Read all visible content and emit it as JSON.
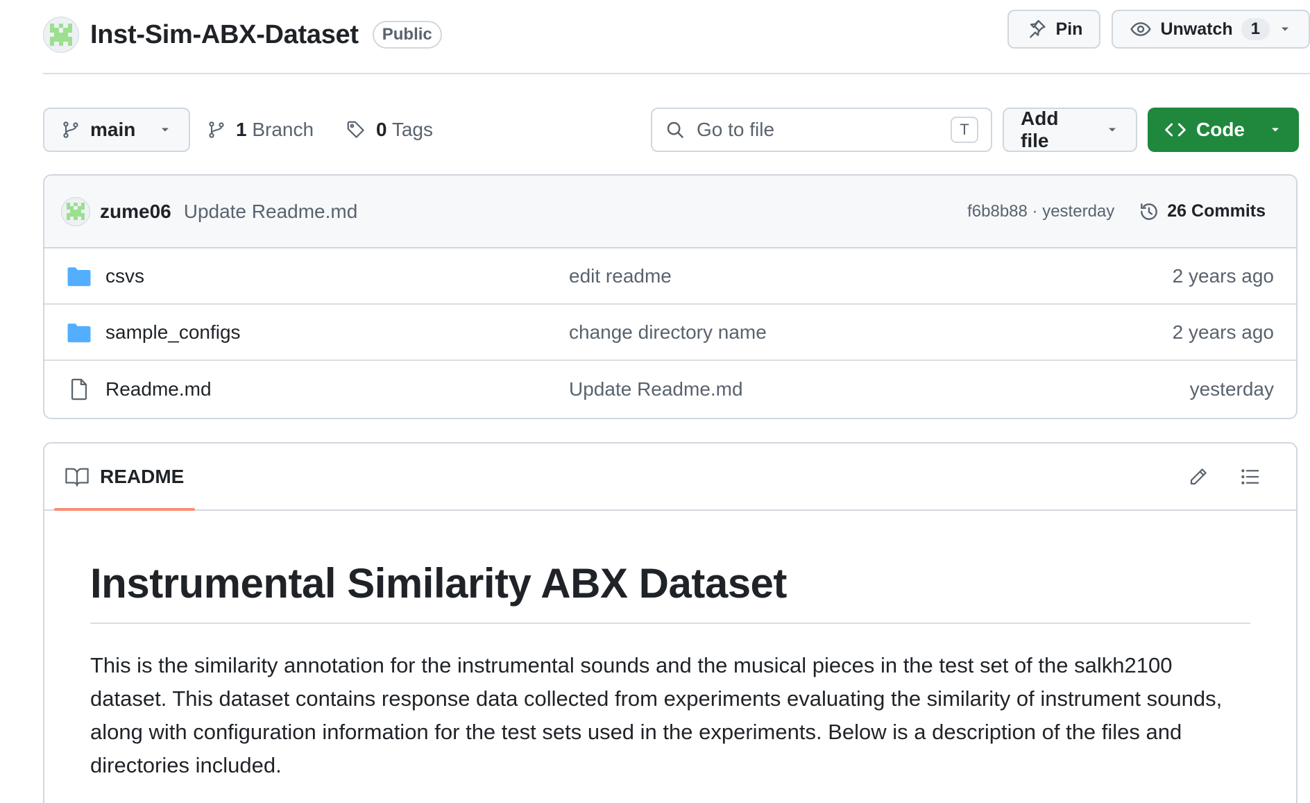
{
  "repo": {
    "name": "Inst-Sim-ABX-Dataset",
    "visibility": "Public",
    "pin_label": "Pin",
    "watch_label": "Unwatch",
    "watch_count": "1"
  },
  "toolbar": {
    "branch": "main",
    "branch_count": "1",
    "branch_label": "Branch",
    "tag_count": "0",
    "tag_label": "Tags",
    "goto_placeholder": "Go to file",
    "goto_shortcut": "T",
    "add_file_label": "Add file",
    "code_label": "Code"
  },
  "latest_commit": {
    "author": "zume06",
    "message": "Update Readme.md",
    "hash_and_time": "f6b8b88 · yesterday",
    "commits_count": "26",
    "commits_label": "Commits"
  },
  "files": [
    {
      "name": "csvs",
      "type": "folder",
      "message": "edit readme",
      "date": "2 years ago"
    },
    {
      "name": "sample_configs",
      "type": "folder",
      "message": "change directory name",
      "date": "2 years ago"
    },
    {
      "name": "Readme.md",
      "type": "file",
      "message": "Update Readme.md",
      "date": "yesterday"
    }
  ],
  "readme": {
    "tab_label": "README",
    "title": "Instrumental Similarity ABX Dataset",
    "paragraph": "This is the similarity annotation for the instrumental sounds and the musical pieces in the test set of the salkh2100 dataset. This dataset contains response data collected from experiments evaluating the similarity of instrument sounds, along with configuration information for the test sets used in the experiments. Below is a description of the files and directories included."
  },
  "colors": {
    "primary_button": "#1f883d",
    "folder_icon": "#54aeff",
    "tab_underline": "#fd8c73",
    "avatar_pattern": "#9be08f"
  },
  "icons": {
    "pin": "pin-icon",
    "watch": "eye-icon",
    "branch": "git-branch-icon",
    "tag": "tag-icon",
    "search": "search-icon",
    "code": "code-icon",
    "history": "history-icon",
    "folder": "folder-icon",
    "file": "file-icon",
    "book": "book-icon",
    "edit": "pencil-icon",
    "outline": "list-icon"
  }
}
